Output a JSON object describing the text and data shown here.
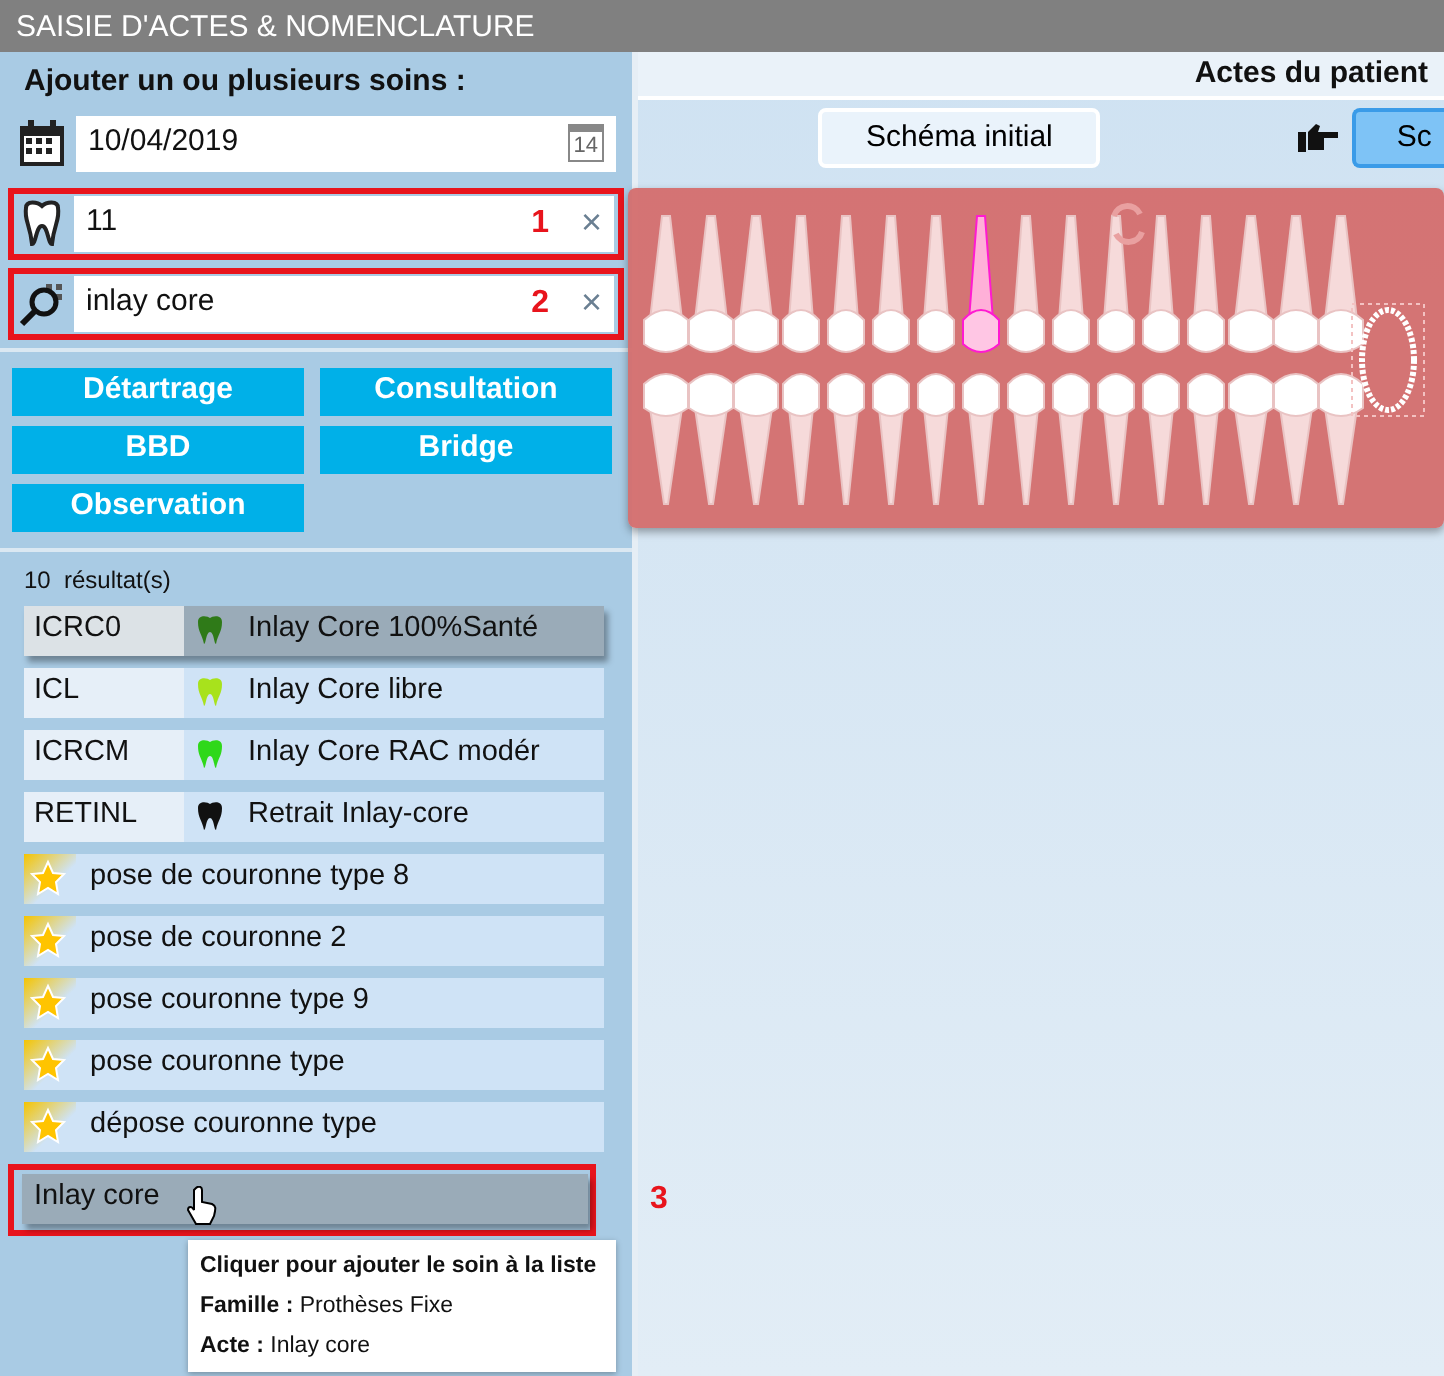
{
  "window": {
    "title": "SAISIE D'ACTES & NOMENCLATURE"
  },
  "left_panel": {
    "heading": "Ajouter un ou plusieurs soins :",
    "date_field": {
      "value": "10/04/2019",
      "picker_day": "14"
    },
    "tooth_field": {
      "value": "11",
      "annotation": "1",
      "clear_symbol": "×"
    },
    "search_field": {
      "value": "inlay core",
      "annotation": "2",
      "clear_symbol": "×"
    },
    "quick_buttons": [
      "Détartrage",
      "Consultation",
      "BBD",
      "Bridge",
      "Observation"
    ],
    "result_count": "10  résultat(s)",
    "results": [
      {
        "kind": "code",
        "code": "ICRC0",
        "label": "Inlay Core 100%Santé",
        "color": "#2f7a18",
        "selected": true
      },
      {
        "kind": "code",
        "code": "ICL",
        "label": "Inlay Core libre",
        "color": "#a8e21c",
        "selected": false
      },
      {
        "kind": "code",
        "code": "ICRCM",
        "label": "Inlay Core RAC modér",
        "color": "#2fd81a",
        "selected": false
      },
      {
        "kind": "code",
        "code": "RETINL",
        "label": "Retrait Inlay-core",
        "color": "#111111",
        "selected": false
      },
      {
        "kind": "favorite",
        "label": "pose de couronne type 8",
        "selected": false
      },
      {
        "kind": "favorite",
        "label": "pose de couronne 2",
        "selected": false
      },
      {
        "kind": "favorite",
        "label": "pose couronne type 9",
        "selected": false
      },
      {
        "kind": "favorite",
        "label": "pose couronne type",
        "selected": false
      },
      {
        "kind": "favorite",
        "label": "dépose couronne type",
        "selected": false
      },
      {
        "kind": "plain",
        "label": "Inlay core",
        "selected": true,
        "annotation": "3"
      }
    ],
    "tooltip": [
      "Cliquer pour ajouter le soin à la liste",
      "**Famille :** Prothèses Fixe",
      "**Acte :** Inlay core"
    ]
  },
  "right_panel": {
    "header": "Actes du patient",
    "buttons": [
      {
        "label": "Schéma initial",
        "selected": false
      },
      {
        "label": "Sc",
        "selected": true
      }
    ],
    "dental_chart": {
      "upper_teeth": [
        {
          "selected": false
        },
        {
          "selected": false
        },
        {
          "selected": false
        },
        {
          "selected": false
        },
        {
          "selected": false
        },
        {
          "selected": false
        },
        {
          "selected": false
        },
        {
          "selected": true
        },
        {
          "selected": false
        },
        {
          "selected": false
        },
        {
          "selected": false
        },
        {
          "selected": false
        },
        {
          "selected": false
        },
        {
          "selected": false
        },
        {
          "selected": false
        },
        {
          "selected": false
        }
      ]
    }
  }
}
